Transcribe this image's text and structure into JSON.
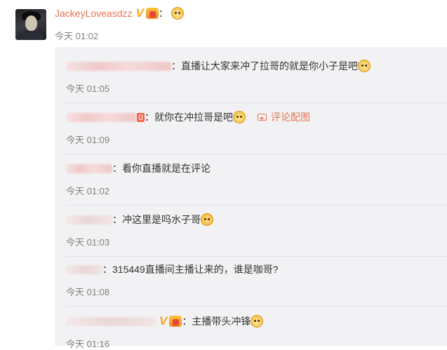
{
  "main_comment": {
    "username": "JackeyLoveasdzz",
    "colon": "：",
    "time": "今天 01:02"
  },
  "replies": [
    {
      "text": "直播让大家来冲了拉哥的就是你小子是吧",
      "time": "今天 01:05",
      "emoji": "doge"
    },
    {
      "text": "就你在冲拉哥是吧",
      "time": "今天 01:09",
      "emoji": "doge",
      "pic_link": "评论配图"
    },
    {
      "text": "看你直播就是在评论",
      "time": "今天 01:02"
    },
    {
      "text": "冲这里是吗水子哥",
      "time": "今天 01:03",
      "emoji": "frightened"
    },
    {
      "text": "315449直播间主播让来的，谁是咖哥?",
      "time": "今天 01:08"
    },
    {
      "text": "主播带头冲锋",
      "time": "今天 01:16",
      "emoji": "doge"
    }
  ],
  "colors": {
    "username": "#eb7350",
    "reply_bg": "#f2f2f5",
    "time": "#808080"
  }
}
